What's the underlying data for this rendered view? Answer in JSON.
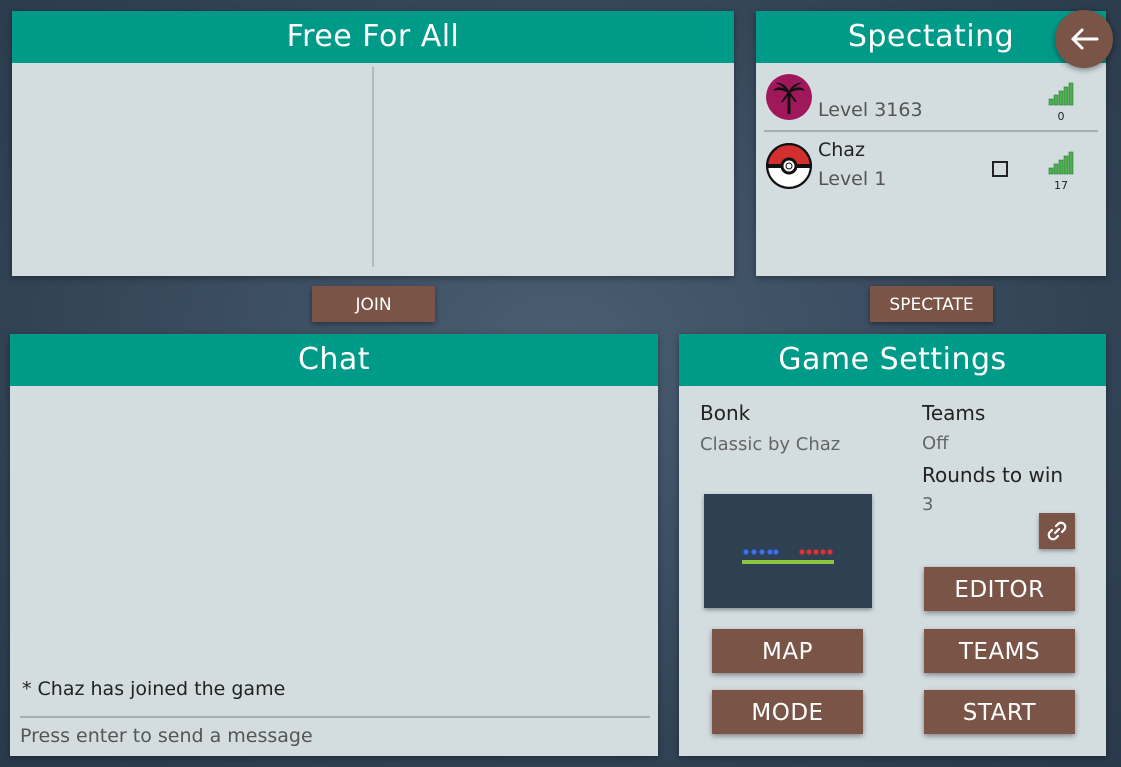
{
  "ffa": {
    "title": "Free For All"
  },
  "spectating": {
    "title": "Spectating",
    "players": [
      {
        "name": "",
        "level": "Level 3163",
        "ping": "0",
        "avatar": "palm-tree-avatar",
        "ready": false
      },
      {
        "name": "Chaz",
        "level": "Level 1",
        "ping": "17",
        "avatar": "pokeball-avatar",
        "ready": true
      }
    ]
  },
  "buttons": {
    "join": "JOIN",
    "spectate": "SPECTATE"
  },
  "chat": {
    "title": "Chat",
    "messages": [
      "* Chaz has joined the game"
    ],
    "input_placeholder": "Press enter to send a message"
  },
  "settings": {
    "title": "Game Settings",
    "mode_name": "Bonk",
    "map_name": "Classic by Chaz",
    "teams_label": "Teams",
    "teams_value": "Off",
    "rounds_label": "Rounds to win",
    "rounds_value": "3",
    "buttons": {
      "editor": "EDITOR",
      "map": "MAP",
      "teams": "TEAMS",
      "mode": "MODE",
      "start": "START"
    }
  },
  "colors": {
    "header": "#009a88",
    "panel": "#d3dcdf",
    "button": "#7a5547",
    "signal": "#4caf50",
    "team_blue": "#3a6ff0",
    "team_red": "#e03030",
    "platform": "#8cc63f"
  }
}
